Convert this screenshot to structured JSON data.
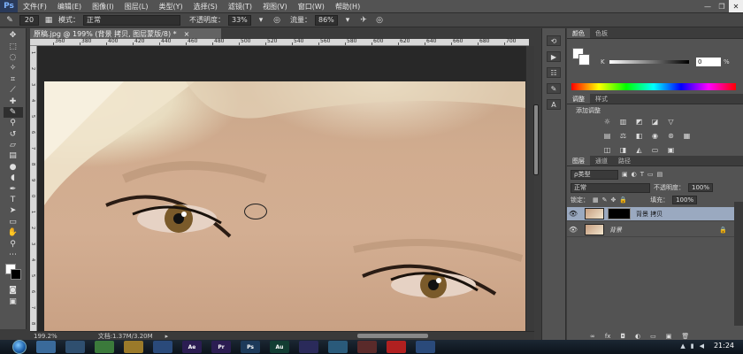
{
  "app": {
    "logo": "Ps"
  },
  "menu": [
    "文件(F)",
    "编辑(E)",
    "图像(I)",
    "图层(L)",
    "类型(Y)",
    "选择(S)",
    "滤镜(T)",
    "视图(V)",
    "窗口(W)",
    "帮助(H)"
  ],
  "window_controls": {
    "minimize": "—",
    "restore": "❐",
    "close": "✕"
  },
  "options": {
    "brush_size": "20",
    "mode_label": "模式：",
    "mode_value": "正常",
    "opacity_label": "不透明度：",
    "opacity_value": "33%",
    "flow_label": "流量：",
    "flow_value": "86%"
  },
  "document": {
    "tab_title": "原稿.jpg @ 199% (背景 拷贝, 图层蒙版/8) *",
    "tab_close": "×",
    "ruler_top": [
      "360",
      "380",
      "400",
      "420",
      "440",
      "460",
      "480",
      "500",
      "520",
      "540",
      "560",
      "580",
      "600",
      "620",
      "640",
      "660",
      "680",
      "700"
    ],
    "ruler_left": [
      "1",
      "2",
      "3",
      "4",
      "5",
      "6",
      "7",
      "8",
      "9",
      "0",
      "1",
      "2",
      "3",
      "4",
      "5",
      "6",
      "7",
      "8"
    ],
    "zoom": "199.2%",
    "doc_size": "文档:1.37M/3.20M"
  },
  "color_panel": {
    "tabs": [
      "颜色",
      "色板"
    ],
    "k_label": "K",
    "k_value": "0",
    "k_unit": "%"
  },
  "adjust_panel": {
    "tabs": [
      "调整",
      "样式"
    ],
    "title": "添加调整"
  },
  "layers_panel": {
    "tabs": [
      "图层",
      "通道",
      "路径"
    ],
    "kind_filter": "ρ类型",
    "blend_mode": "正常",
    "opacity_label": "不透明度：",
    "opacity_value": "100%",
    "lock_label": "锁定：",
    "fill_label": "填充：",
    "fill_value": "100%",
    "layers": [
      {
        "name": "背景 拷贝",
        "selected": true,
        "has_mask": true
      },
      {
        "name": "背景",
        "selected": false,
        "has_mask": false,
        "locked": true
      }
    ],
    "bottom_icons": [
      "∞",
      "fx",
      "◘",
      "◐",
      "▭",
      "▣",
      "🗑"
    ]
  },
  "taskbar": {
    "apps": [
      {
        "name": "explorer",
        "label": "",
        "color": "#3a6a9a"
      },
      {
        "name": "media",
        "label": "",
        "color": "#2f4f6f"
      },
      {
        "name": "chrome",
        "label": "",
        "color": "#3b7a3b"
      },
      {
        "name": "folder",
        "label": "",
        "color": "#9a7a2a"
      },
      {
        "name": "player",
        "label": "",
        "color": "#2a4a7a"
      },
      {
        "name": "after-effects",
        "label": "Ae",
        "color": "#2b1d52"
      },
      {
        "name": "premiere",
        "label": "Pr",
        "color": "#2b1d52"
      },
      {
        "name": "photoshop",
        "label": "Ps",
        "color": "#1d3a5a"
      },
      {
        "name": "audition",
        "label": "Au",
        "color": "#123d33"
      },
      {
        "name": "media-encoder",
        "label": "",
        "color": "#2a2a5a"
      },
      {
        "name": "browser",
        "label": "",
        "color": "#2a5a7a"
      },
      {
        "name": "tool",
        "label": "",
        "color": "#5a2a2a"
      },
      {
        "name": "record",
        "label": "",
        "color": "#b02020"
      },
      {
        "name": "ps-active",
        "label": "",
        "color": "#2a4a7a"
      }
    ],
    "time": "21:24"
  }
}
